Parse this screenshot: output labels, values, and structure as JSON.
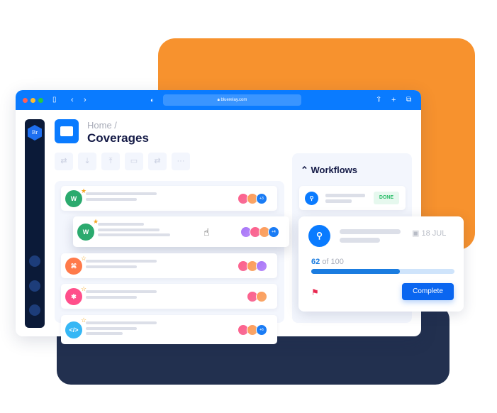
{
  "browser": {
    "url": "bluerelay.com"
  },
  "app": {
    "logo_text": "Br",
    "breadcrumb": "Home /",
    "page_title": "Coverages",
    "toolbar_more": "···",
    "files": [
      {
        "type": "word",
        "icon_letter": "W",
        "color": "#2BAA6E",
        "starred": true,
        "avatars_more": "+3"
      },
      {
        "type": "word",
        "icon_letter": "W",
        "color": "#2BAA6E",
        "starred": true,
        "avatars_more": "+4"
      },
      {
        "type": "pdf",
        "color": "#FF7A4A",
        "starred": false
      },
      {
        "type": "image",
        "color": "#FF4F8B",
        "starred": false
      },
      {
        "type": "code",
        "icon_letter": "</>",
        "color": "#36B7F5",
        "starred": false,
        "avatars_more": "+6"
      }
    ]
  },
  "workflows": {
    "title": "Workflows",
    "item_status": "DONE",
    "card": {
      "date": "18 JUL",
      "progress_value": "62",
      "progress_total": "of 100",
      "progress_fraction": 0.62,
      "complete_label": "Complete"
    }
  },
  "colors": {
    "accent": "#0A7BFF",
    "orange": "#F7922E",
    "navy": "#22304F",
    "done": "#2BBE6A"
  }
}
